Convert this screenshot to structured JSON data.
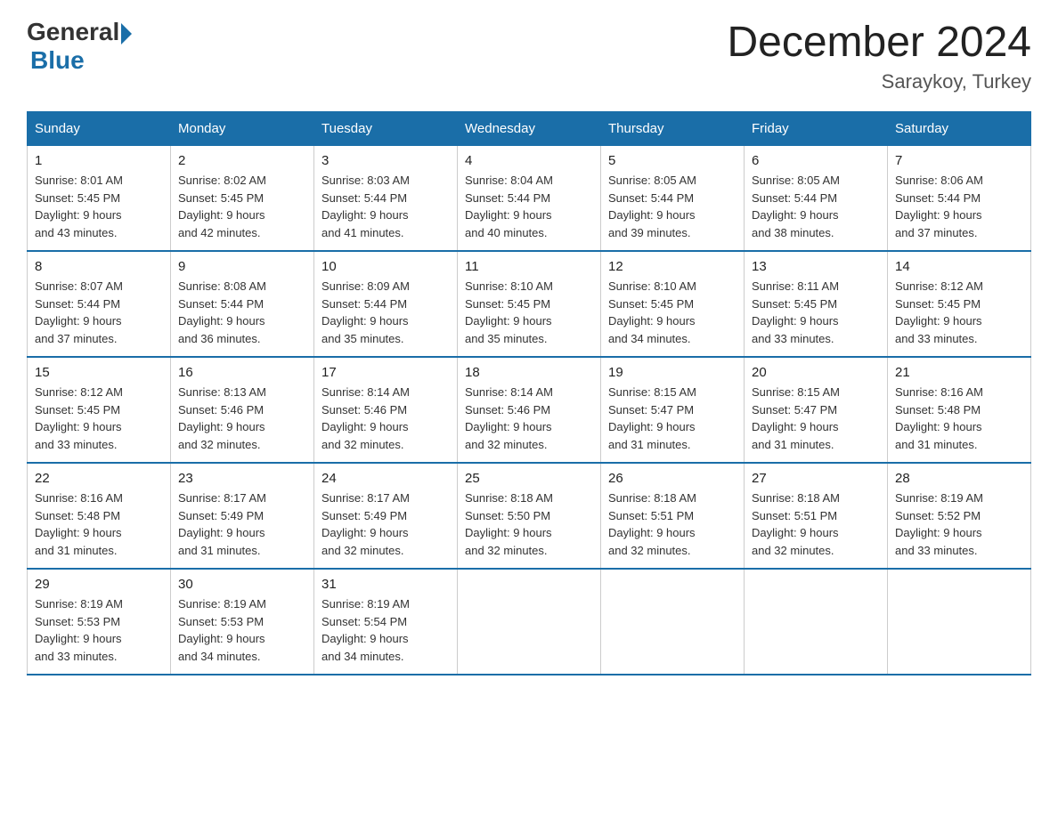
{
  "logo": {
    "general": "General",
    "blue": "Blue"
  },
  "title": {
    "month_year": "December 2024",
    "location": "Saraykoy, Turkey"
  },
  "weekdays": [
    "Sunday",
    "Monday",
    "Tuesday",
    "Wednesday",
    "Thursday",
    "Friday",
    "Saturday"
  ],
  "weeks": [
    [
      {
        "day": "1",
        "sunrise": "8:01 AM",
        "sunset": "5:45 PM",
        "daylight": "9 hours and 43 minutes."
      },
      {
        "day": "2",
        "sunrise": "8:02 AM",
        "sunset": "5:45 PM",
        "daylight": "9 hours and 42 minutes."
      },
      {
        "day": "3",
        "sunrise": "8:03 AM",
        "sunset": "5:44 PM",
        "daylight": "9 hours and 41 minutes."
      },
      {
        "day": "4",
        "sunrise": "8:04 AM",
        "sunset": "5:44 PM",
        "daylight": "9 hours and 40 minutes."
      },
      {
        "day": "5",
        "sunrise": "8:05 AM",
        "sunset": "5:44 PM",
        "daylight": "9 hours and 39 minutes."
      },
      {
        "day": "6",
        "sunrise": "8:05 AM",
        "sunset": "5:44 PM",
        "daylight": "9 hours and 38 minutes."
      },
      {
        "day": "7",
        "sunrise": "8:06 AM",
        "sunset": "5:44 PM",
        "daylight": "9 hours and 37 minutes."
      }
    ],
    [
      {
        "day": "8",
        "sunrise": "8:07 AM",
        "sunset": "5:44 PM",
        "daylight": "9 hours and 37 minutes."
      },
      {
        "day": "9",
        "sunrise": "8:08 AM",
        "sunset": "5:44 PM",
        "daylight": "9 hours and 36 minutes."
      },
      {
        "day": "10",
        "sunrise": "8:09 AM",
        "sunset": "5:44 PM",
        "daylight": "9 hours and 35 minutes."
      },
      {
        "day": "11",
        "sunrise": "8:10 AM",
        "sunset": "5:45 PM",
        "daylight": "9 hours and 35 minutes."
      },
      {
        "day": "12",
        "sunrise": "8:10 AM",
        "sunset": "5:45 PM",
        "daylight": "9 hours and 34 minutes."
      },
      {
        "day": "13",
        "sunrise": "8:11 AM",
        "sunset": "5:45 PM",
        "daylight": "9 hours and 33 minutes."
      },
      {
        "day": "14",
        "sunrise": "8:12 AM",
        "sunset": "5:45 PM",
        "daylight": "9 hours and 33 minutes."
      }
    ],
    [
      {
        "day": "15",
        "sunrise": "8:12 AM",
        "sunset": "5:45 PM",
        "daylight": "9 hours and 33 minutes."
      },
      {
        "day": "16",
        "sunrise": "8:13 AM",
        "sunset": "5:46 PM",
        "daylight": "9 hours and 32 minutes."
      },
      {
        "day": "17",
        "sunrise": "8:14 AM",
        "sunset": "5:46 PM",
        "daylight": "9 hours and 32 minutes."
      },
      {
        "day": "18",
        "sunrise": "8:14 AM",
        "sunset": "5:46 PM",
        "daylight": "9 hours and 32 minutes."
      },
      {
        "day": "19",
        "sunrise": "8:15 AM",
        "sunset": "5:47 PM",
        "daylight": "9 hours and 31 minutes."
      },
      {
        "day": "20",
        "sunrise": "8:15 AM",
        "sunset": "5:47 PM",
        "daylight": "9 hours and 31 minutes."
      },
      {
        "day": "21",
        "sunrise": "8:16 AM",
        "sunset": "5:48 PM",
        "daylight": "9 hours and 31 minutes."
      }
    ],
    [
      {
        "day": "22",
        "sunrise": "8:16 AM",
        "sunset": "5:48 PM",
        "daylight": "9 hours and 31 minutes."
      },
      {
        "day": "23",
        "sunrise": "8:17 AM",
        "sunset": "5:49 PM",
        "daylight": "9 hours and 31 minutes."
      },
      {
        "day": "24",
        "sunrise": "8:17 AM",
        "sunset": "5:49 PM",
        "daylight": "9 hours and 32 minutes."
      },
      {
        "day": "25",
        "sunrise": "8:18 AM",
        "sunset": "5:50 PM",
        "daylight": "9 hours and 32 minutes."
      },
      {
        "day": "26",
        "sunrise": "8:18 AM",
        "sunset": "5:51 PM",
        "daylight": "9 hours and 32 minutes."
      },
      {
        "day": "27",
        "sunrise": "8:18 AM",
        "sunset": "5:51 PM",
        "daylight": "9 hours and 32 minutes."
      },
      {
        "day": "28",
        "sunrise": "8:19 AM",
        "sunset": "5:52 PM",
        "daylight": "9 hours and 33 minutes."
      }
    ],
    [
      {
        "day": "29",
        "sunrise": "8:19 AM",
        "sunset": "5:53 PM",
        "daylight": "9 hours and 33 minutes."
      },
      {
        "day": "30",
        "sunrise": "8:19 AM",
        "sunset": "5:53 PM",
        "daylight": "9 hours and 34 minutes."
      },
      {
        "day": "31",
        "sunrise": "8:19 AM",
        "sunset": "5:54 PM",
        "daylight": "9 hours and 34 minutes."
      },
      null,
      null,
      null,
      null
    ]
  ],
  "labels": {
    "sunrise": "Sunrise:",
    "sunset": "Sunset:",
    "daylight": "Daylight:"
  }
}
